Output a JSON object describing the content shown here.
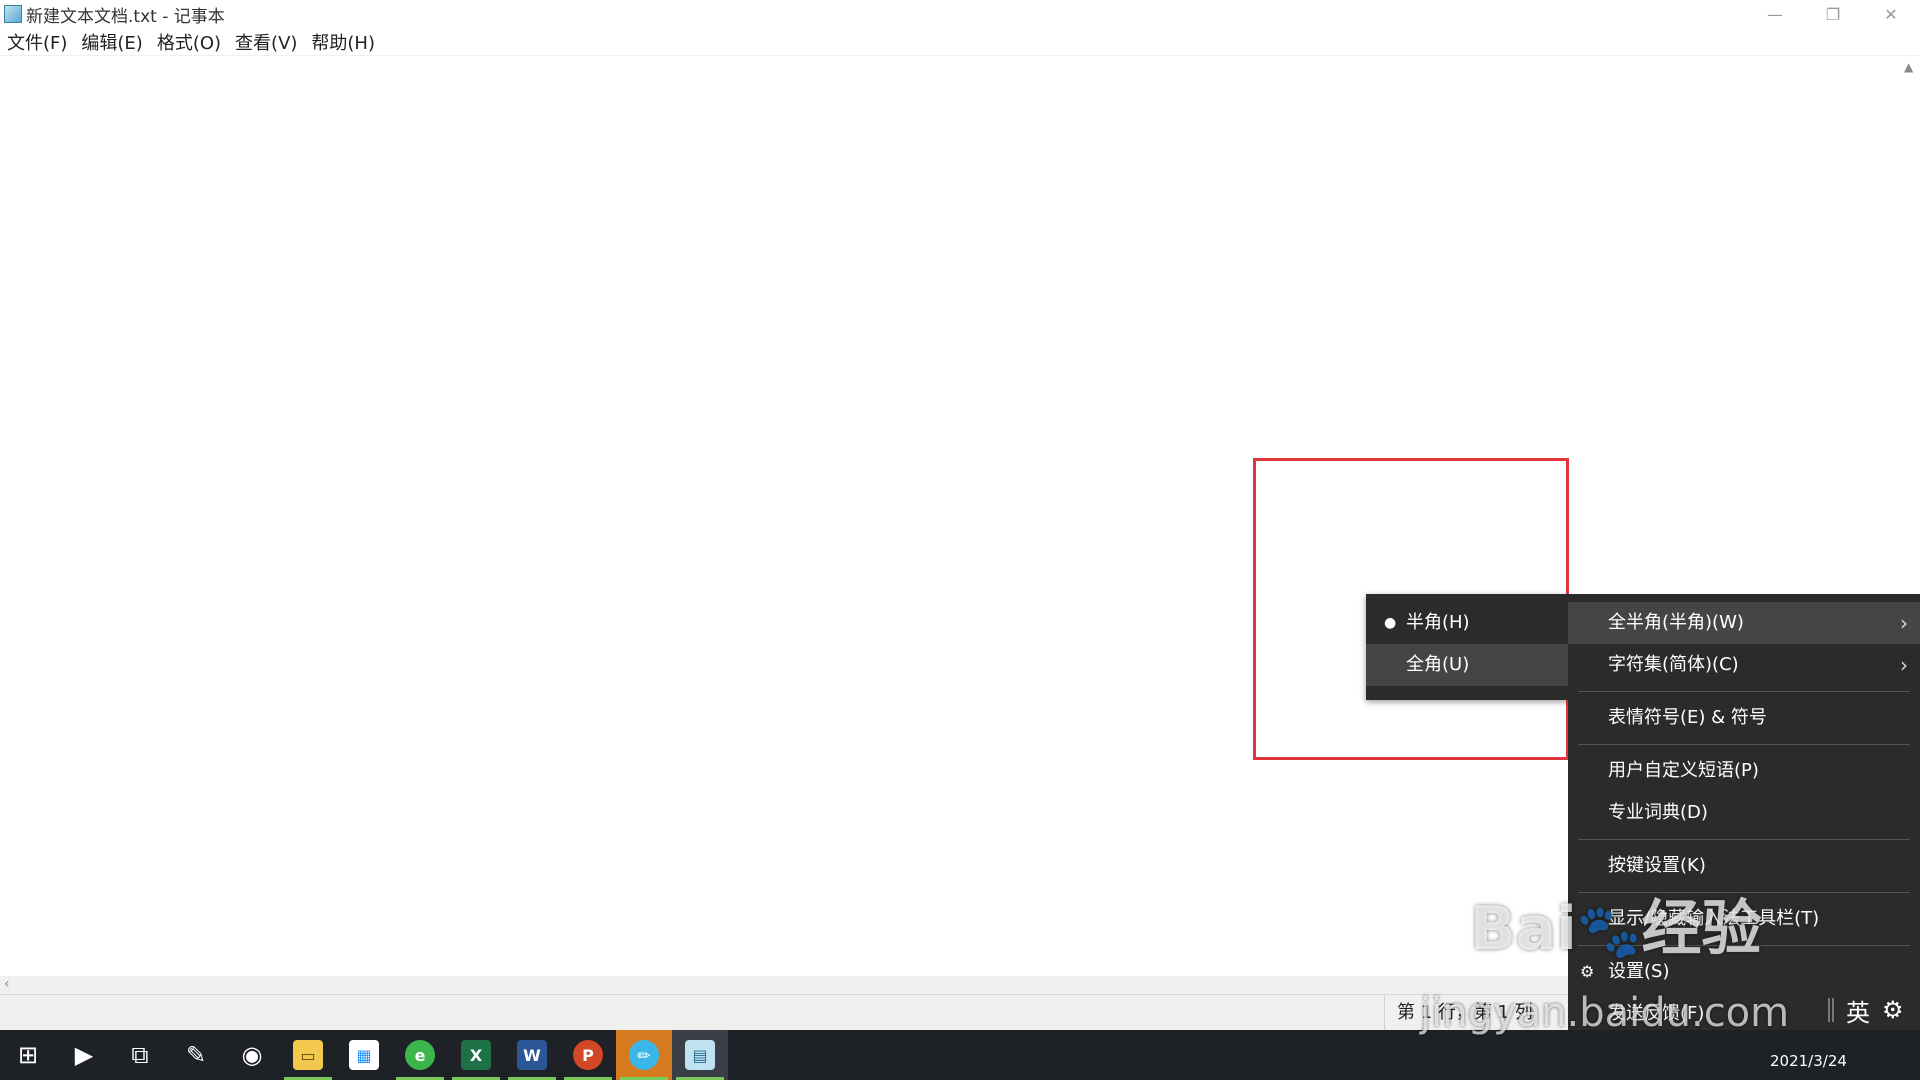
{
  "window": {
    "title": "新建文本文档.txt - 记事本",
    "controls": {
      "minimize": "—",
      "restore": "❐",
      "close": "✕"
    }
  },
  "menubar": [
    "文件(F)",
    "编辑(E)",
    "格式(O)",
    "查看(V)",
    "帮助(H)"
  ],
  "statusbar": {
    "position": "第 1 行，第 1 列"
  },
  "submenu": {
    "items": [
      {
        "label": "半角(H)",
        "selected": true
      },
      {
        "label": "全角(U)",
        "selected": false
      }
    ]
  },
  "context_menu": {
    "items": [
      "全半角(半角)(W)",
      "字符集(简体)(C)",
      "表情符号(E) & 符号",
      "用户自定义短语(P)",
      "专业词典(D)",
      "按键设置(K)",
      "显示/隐藏输入法工具栏(T)",
      "设置(S)",
      "发送反馈(F)"
    ]
  },
  "ime": {
    "language": "英"
  },
  "taskbar": {
    "date": "2021/3/24",
    "icons": [
      "windows-start",
      "media",
      "task-view",
      "pen",
      "edge",
      "file-explorer",
      "store",
      "browser",
      "excel",
      "word",
      "powerpoint",
      "pencil-app",
      "notepad"
    ]
  },
  "watermark": {
    "brand": "Baidu 经验",
    "url": "jingyan.baidu.com"
  },
  "colors": {
    "highlight": "#e0343a",
    "menu_bg": "#2b2b2b",
    "taskbar_bg": "#1e2126"
  }
}
